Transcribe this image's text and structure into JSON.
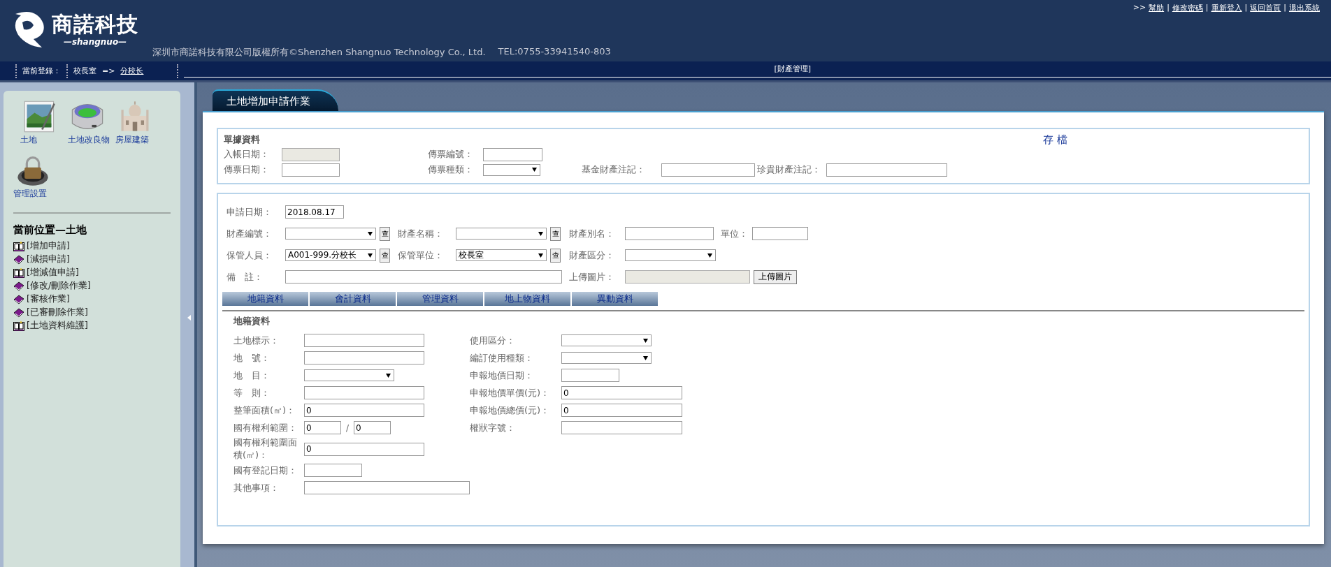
{
  "header": {
    "logo_title": "商諾科技",
    "logo_subtitle": "—shangnuo—",
    "copyright": "深圳市商諾科技有限公司版權所有©Shenzhen Shangnuo Technology Co., Ltd.",
    "tel": "TEL:0755-33941540-803",
    "links_prefix": ">>",
    "link_separator": "|",
    "links": [
      "幫助",
      "修改密碼",
      "重新登入",
      "返回首頁",
      "退出系統"
    ]
  },
  "nav": {
    "login_label": "當前登錄：",
    "office": "校長室",
    "arrow": "=>",
    "user": "分校长",
    "module": "[財產管理]"
  },
  "sidebar": {
    "modules": [
      {
        "label": "土地",
        "kind": "photo"
      },
      {
        "label": "土地改良物",
        "kind": "stadium"
      },
      {
        "label": "房屋建築",
        "kind": "palace"
      },
      {
        "label": "管理設置",
        "kind": "lock"
      }
    ],
    "location_title": "當前位置—土地",
    "items": [
      {
        "label": "[增加申請]",
        "kind": "open"
      },
      {
        "label": "[減損申請]",
        "kind": "closed"
      },
      {
        "label": "[增減值申請]",
        "kind": "open"
      },
      {
        "label": "[修改/刪除作業]",
        "kind": "closed"
      },
      {
        "label": "[審核作業]",
        "kind": "closed"
      },
      {
        "label": "[已審刪除作業]",
        "kind": "closed"
      },
      {
        "label": "[土地資料維護]",
        "kind": "open"
      }
    ]
  },
  "page_tab": "土地增加申請作業",
  "voucher": {
    "title": "單據資料",
    "save": "存 檔",
    "rows": [
      [
        {
          "label": "入帳日期：",
          "kind": "disabled"
        },
        {
          "label": "傳票編號：",
          "kind": "text"
        }
      ],
      [
        {
          "label": "傳票日期：",
          "kind": "text"
        },
        {
          "label": "傳票種類：",
          "kind": "select"
        },
        {
          "label": "基金財產注記：",
          "kind": "text"
        },
        {
          "label": "珍貴財產注記：",
          "kind": "text"
        }
      ]
    ]
  },
  "application": {
    "rows": [
      [
        {
          "label": "申請日期：",
          "kind": "text",
          "value": "2018.08.17"
        }
      ],
      [
        {
          "label": "財產編號：",
          "kind": "select",
          "lookup": "查"
        },
        {
          "label": "財產名稱：",
          "kind": "select",
          "lookup": "查"
        },
        {
          "label": "財產別名：",
          "kind": "text"
        },
        {
          "label": "單位：",
          "kind": "text"
        }
      ],
      [
        {
          "label": "保管人員：",
          "kind": "select",
          "value": "A001-999.分校长",
          "lookup": "查"
        },
        {
          "label": "保管單位：",
          "kind": "select",
          "value": "校長室",
          "lookup": "查"
        },
        {
          "label": "財產區分：",
          "kind": "select"
        }
      ],
      [
        {
          "label": "備　註：",
          "kind": "text"
        },
        "",
        {
          "label": "上傳圖片：",
          "kind": "disabled",
          "button": "上傳圖片"
        }
      ]
    ]
  },
  "tabs": [
    {
      "label": "地籍資料"
    },
    {
      "label": "會計資料"
    },
    {
      "label": "管理資料"
    },
    {
      "label": "地上物資料"
    },
    {
      "label": "異動資料"
    }
  ],
  "land": {
    "title": "地籍資料",
    "rows": [
      {
        "left": {
          "label": "土地標示：",
          "kind": "text"
        },
        "right": {
          "label": "使用區分：",
          "kind": "select"
        }
      },
      {
        "left": {
          "label": "地　號：",
          "kind": "text"
        },
        "right": {
          "label": "編訂使用種類：",
          "kind": "select"
        }
      },
      {
        "left": {
          "label": "地　目：",
          "kind": "select"
        },
        "right": {
          "label": "申報地價日期：",
          "kind": "date"
        }
      },
      {
        "left": {
          "label": "等　則：",
          "kind": "text"
        },
        "right": {
          "label": "申報地價單價(元)：",
          "kind": "text",
          "value": "0"
        }
      },
      {
        "left": {
          "label": "整筆面積(㎡)：",
          "kind": "text",
          "value": "0"
        },
        "right": {
          "label": "申報地價總價(元)：",
          "kind": "text",
          "value": "0"
        }
      },
      {
        "left": {
          "label": "國有權利範圍：",
          "kind": "ratio",
          "values": [
            "0",
            "0"
          ],
          "separator": "/"
        },
        "right": {
          "label": "權狀字號：",
          "kind": "text"
        }
      },
      {
        "left": {
          "label": "國有權利範圍面積(㎡)：",
          "kind": "text",
          "value": "0"
        }
      },
      {
        "left": {
          "label": "國有登記日期：",
          "kind": "date"
        }
      },
      {
        "left": {
          "label": "其他事項：",
          "kind": "wide"
        }
      }
    ]
  }
}
